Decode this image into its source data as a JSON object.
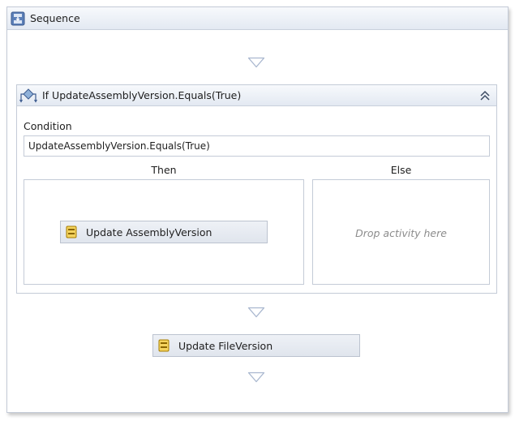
{
  "sequence": {
    "title": "Sequence",
    "icon": "sequence-icon"
  },
  "if_activity": {
    "title": "If UpdateAssemblyVersion.Equals(True)",
    "icon": "if-activity-icon",
    "collapse_icon": "chevron-double-up-icon",
    "condition_label": "Condition",
    "condition_value": "UpdateAssemblyVersion.Equals(True)",
    "then_label": "Then",
    "else_label": "Else",
    "else_placeholder": "Drop activity here",
    "then_activity": {
      "label": "Update AssemblyVersion",
      "icon": "assign-activity-icon"
    }
  },
  "activities": [
    {
      "label": "Update FileVersion",
      "icon": "assign-activity-icon"
    }
  ],
  "drop_markers": [
    "drop-arrow-icon",
    "drop-arrow-icon",
    "drop-arrow-icon"
  ],
  "colors": {
    "header_gradient_top": "#f7f9fc",
    "header_gradient_bottom": "#e3e9f2",
    "border": "#c4cbd7",
    "drop_arrow": "#a9b7cf",
    "placeholder_text": "#8c8c8c"
  }
}
